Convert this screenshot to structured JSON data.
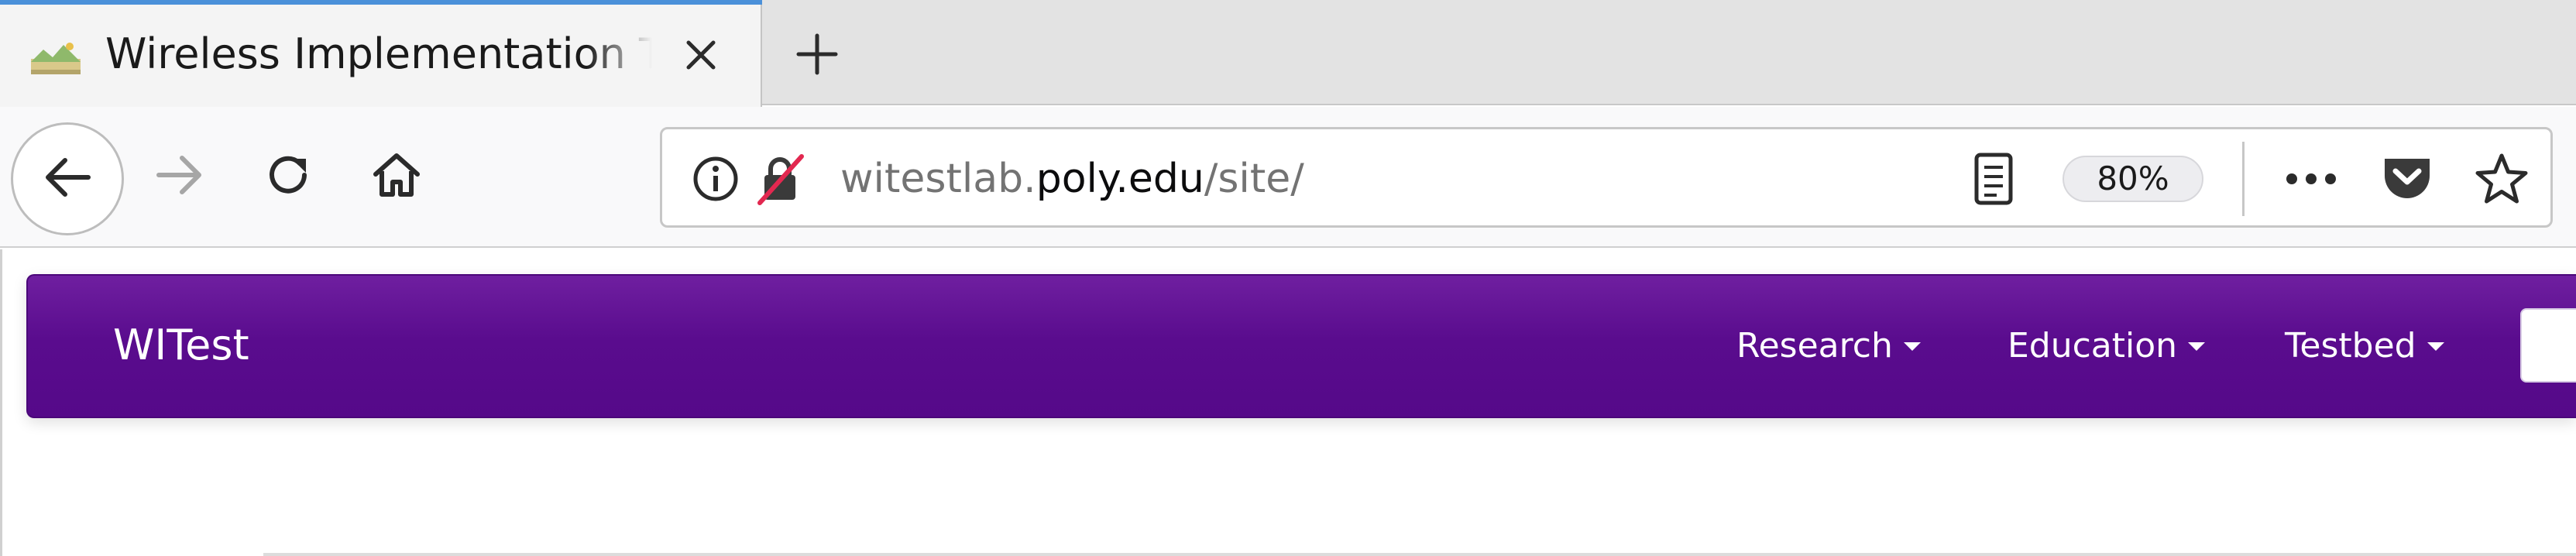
{
  "browser": {
    "tab": {
      "title": "Wireless Implementation Testbed Laboratory",
      "favicon": "landscape-icon"
    },
    "toolbar": {
      "icons": [
        "back-arrow-icon",
        "forward-arrow-icon",
        "reload-icon",
        "home-icon"
      ]
    },
    "urlbar": {
      "url_prefix": "witestlab.",
      "url_domain": "poly.edu",
      "url_path": "/site/",
      "zoom": "80%",
      "icons": [
        "info-icon",
        "insecure-lock-icon",
        "reader-view-icon",
        "more-actions-icon",
        "pocket-icon",
        "bookmark-star-icon"
      ]
    }
  },
  "site": {
    "brand": "WITest",
    "menu": [
      {
        "label": "Research"
      },
      {
        "label": "Education"
      },
      {
        "label": "Testbed"
      }
    ],
    "colors": {
      "navbar": "#57098a",
      "accent_tab": "#4a90d9"
    }
  }
}
